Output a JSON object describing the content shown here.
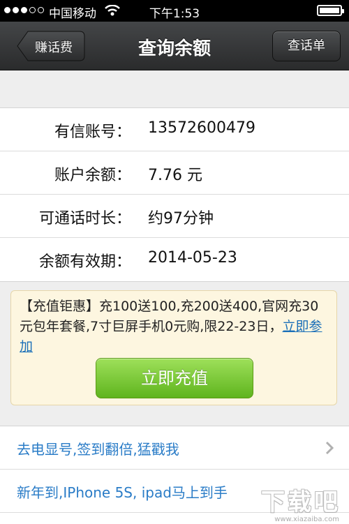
{
  "status_bar": {
    "carrier": "中国移动",
    "time": "下午1:53",
    "signal_strength": 3,
    "signal_max": 5
  },
  "nav": {
    "back_label": "赚话费",
    "title": "查询余额",
    "right_label": "查话单"
  },
  "info": {
    "rows": [
      {
        "label": "有信账号：",
        "value": "13572600479"
      },
      {
        "label": "账户余额：",
        "value": "7.76 元"
      },
      {
        "label": "可通话时长：",
        "value": "约97分钟"
      },
      {
        "label": "余额有效期：",
        "value": "2014-05-23"
      }
    ]
  },
  "promo": {
    "text": "【充值钜惠】充100送100,充200送400,官网充30元包年套餐,7寸巨屏手机0元购,限22-23日，",
    "link": "立即参加",
    "button": "立即充值"
  },
  "links": [
    {
      "label": "去电显号,签到翻倍,猛戳我",
      "icon": "chevron-right-icon"
    },
    {
      "label": "新年到,IPhone 5S, ipad马上到手"
    }
  ],
  "watermark": {
    "logo": "下载吧",
    "url": "www.xiazaiba.com"
  },
  "colors": {
    "nav_bg": "#333435",
    "link_blue": "#2a7cc7",
    "promo_bg": "#fdf6e0",
    "button_green": "#6cc425"
  }
}
